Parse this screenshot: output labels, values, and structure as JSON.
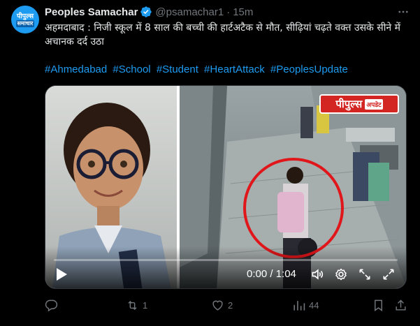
{
  "tweet": {
    "avatar": {
      "line1": "पीपुल्स",
      "line2": "समाचार"
    },
    "display_name": "Peoples Samachar",
    "handle": "@psamachar1",
    "separator": "·",
    "time": "15m",
    "text": "अहमदाबाद : निजी स्कूल में 8 साल की बच्ची की हार्टअटैक से मौत, सीढ़ियां चढ़ते वक्त उसके सीने में अचानक दर्द उठा",
    "hashtags": [
      "#Ahmedabad",
      "#School",
      "#Student",
      "#HeartAttack",
      "#PeoplesUpdate"
    ]
  },
  "media": {
    "badge_main": "पीपुल्स",
    "badge_sub": "अपडेट",
    "timecode": "0:00 / 1:04",
    "progress": 0
  },
  "actions": {
    "reply_count": "",
    "retweet_count": "1",
    "like_count": "2",
    "views_count": "44"
  },
  "colors": {
    "background": "#000000",
    "text": "#e7e9ea",
    "muted": "#71767b",
    "link": "#1d9bf0",
    "highlight_circle": "#e0161a",
    "badge": "#d32622"
  },
  "icons": [
    "verified-badge-icon",
    "more-icon",
    "play-icon",
    "volume-icon",
    "settings-icon",
    "expand-icon",
    "fullscreen-icon",
    "reply-icon",
    "retweet-icon",
    "like-icon",
    "views-icon",
    "bookmark-icon",
    "share-icon"
  ]
}
